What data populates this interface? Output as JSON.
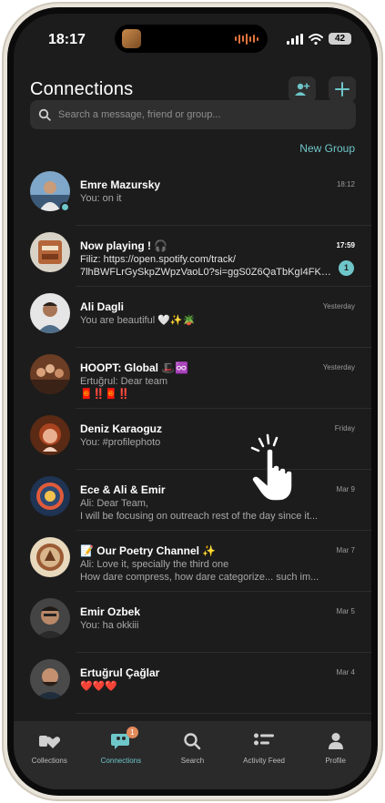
{
  "status_bar": {
    "time": "18:17",
    "battery": "42"
  },
  "header": {
    "title": "Connections"
  },
  "search": {
    "placeholder": "Search a message, friend or group..."
  },
  "new_group_label": "New Group",
  "conversations": [
    {
      "name": "Emre Mazursky",
      "lines": [
        "You: on it"
      ],
      "time": "18:12"
    },
    {
      "name": "Now playing ! 🎧",
      "lines": [
        "Filiz: https://open.spotify.com/track/",
        "7lhBWFLrGySkpZWpzVaoL0?si=ggS0Z6QaTbKgI4FK2Lj..."
      ],
      "time": "17:59",
      "unread": "1"
    },
    {
      "name": "Ali Dagli",
      "lines": [
        "You are beautiful 🤍✨🪴"
      ],
      "time": "Yesterday"
    },
    {
      "name": "HOOPT: Global 🎩♾️",
      "lines": [
        "Ertuğrul: Dear team",
        "🧧‼️🧧‼️"
      ],
      "time": "Yesterday"
    },
    {
      "name": "Deniz Karaoguz",
      "lines": [
        "You: #profilephoto"
      ],
      "time": "Friday"
    },
    {
      "name": "Ece & Ali & Emir",
      "lines": [
        "Ali: Dear Team,",
        "I will be focusing on outreach rest of the day since it..."
      ],
      "time": "Mar 9"
    },
    {
      "name": "📝 Our Poetry Channel ✨",
      "lines": [
        "Ali: Love it, specially the third one",
        "How dare compress, how dare categorize... such im..."
      ],
      "time": "Mar 7"
    },
    {
      "name": "Emir Ozbek",
      "lines": [
        "You: ha okkiii"
      ],
      "time": "Mar 5"
    },
    {
      "name": "Ertuğrul Çağlar",
      "lines": [
        "❤️❤️❤️"
      ],
      "time": "Mar 4"
    }
  ],
  "tabs": [
    {
      "label": "Collections",
      "icon": "heart-cards-icon"
    },
    {
      "label": "Connections",
      "icon": "chat-people-icon",
      "badge": "1",
      "active": true
    },
    {
      "label": "Search",
      "icon": "search-icon"
    },
    {
      "label": "Activity Feed",
      "icon": "feed-list-icon"
    },
    {
      "label": "Profile",
      "icon": "person-icon"
    }
  ],
  "colors": {
    "accent": "#6ec6c9",
    "background": "#1c1c1c",
    "badge": "#e28a5c"
  }
}
